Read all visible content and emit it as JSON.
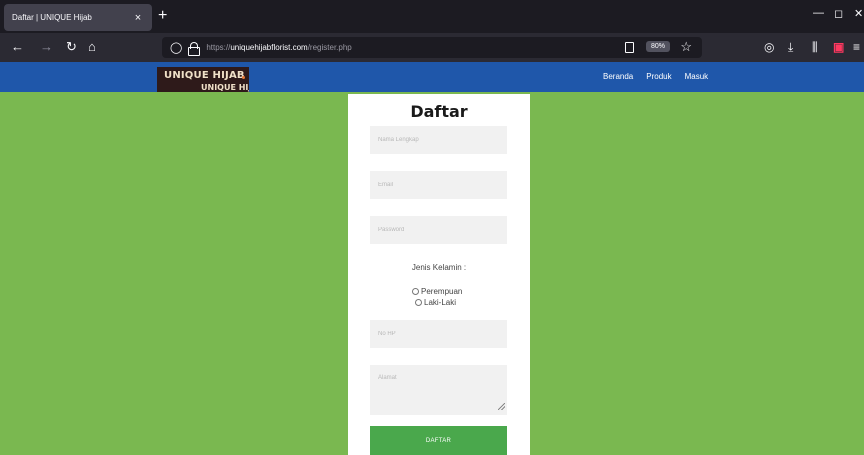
{
  "browser": {
    "tab_title": "Daftar | UNIQUE Hijab",
    "tab_close": "×",
    "new_tab": "+",
    "url_prefix": "https://",
    "url_host": "uniquehijabflorist.com",
    "url_path": "/register.php",
    "zoom": "80%",
    "icons": [
      "back-arrow-icon",
      "forward-arrow-icon",
      "reload-icon",
      "home-icon",
      "shield-icon",
      "lock-icon",
      "reader-view-icon",
      "bookmark-star-icon",
      "pocket-icon",
      "download-icon",
      "library-icon",
      "extension-icon",
      "menu-icon"
    ]
  },
  "site": {
    "logo_line1": "UNIQUE HIJAB",
    "logo_line2": "UNIQUE HIJ",
    "nav": [
      "Beranda",
      "Produk",
      "Masuk"
    ]
  },
  "form": {
    "title": "Daftar",
    "name_placeholder": "Nama Lengkap",
    "email_placeholder": "Email",
    "password_placeholder": "Password",
    "gender_label": "Jenis Kelamin :",
    "gender_options": [
      "Perempuan",
      "Laki-Laki"
    ],
    "phone_placeholder": "No HP",
    "address_placeholder": "Alamat",
    "submit_label": "DAFTAR"
  },
  "colors": {
    "page_bg": "#7ab850",
    "header_bg": "#1f57aa",
    "button_bg": "#4aa84c"
  }
}
